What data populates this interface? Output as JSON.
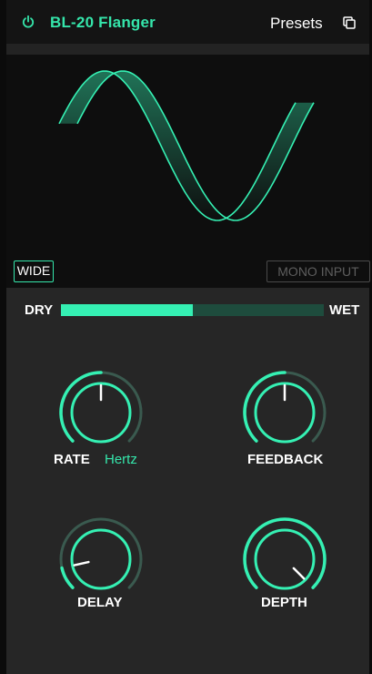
{
  "header": {
    "title": "BL-20 Flanger",
    "presets_label": "Presets",
    "power_icon": "power-icon",
    "copy_icon": "copy-icon"
  },
  "visual": {
    "wide_label": "WIDE",
    "mono_input_label": "MONO INPUT"
  },
  "mix": {
    "dry_label": "DRY",
    "wet_label": "WET",
    "value": 0.5
  },
  "knobs": {
    "rate": {
      "label": "RATE",
      "unit": "Hertz",
      "value": 0.5
    },
    "feedback": {
      "label": "FEEDBACK",
      "value": 0.5
    },
    "delay": {
      "label": "DELAY",
      "value": 0.12
    },
    "depth": {
      "label": "DEPTH",
      "value": 1.0
    }
  },
  "colors": {
    "accent": "#35e6ab",
    "accent_bright": "#35f0b3",
    "track_dim": "#1e4c3d",
    "arc_dim": "#3a5a4f",
    "panel": "#262626"
  }
}
